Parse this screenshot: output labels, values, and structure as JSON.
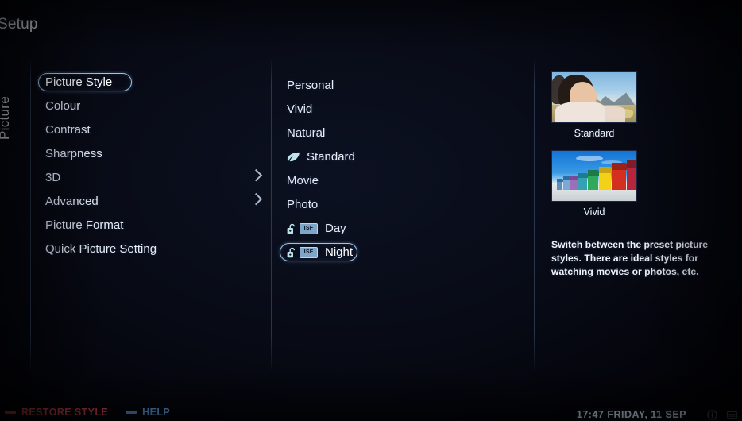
{
  "header": {
    "title": "Setup",
    "category_label": "Picture"
  },
  "left_menu": {
    "items": [
      {
        "label": "Picture Style",
        "selected": true,
        "has_submenu": false
      },
      {
        "label": "Colour",
        "selected": false,
        "has_submenu": false
      },
      {
        "label": "Contrast",
        "selected": false,
        "has_submenu": false
      },
      {
        "label": "Sharpness",
        "selected": false,
        "has_submenu": false
      },
      {
        "label": "3D",
        "selected": false,
        "has_submenu": true
      },
      {
        "label": "Advanced",
        "selected": false,
        "has_submenu": true
      },
      {
        "label": "Picture Format",
        "selected": false,
        "has_submenu": false
      },
      {
        "label": "Quick Picture Setting",
        "selected": false,
        "has_submenu": false
      }
    ]
  },
  "style_list": {
    "items": [
      {
        "label": "Personal",
        "selected": false,
        "icons": []
      },
      {
        "label": "Vivid",
        "selected": false,
        "icons": []
      },
      {
        "label": "Natural",
        "selected": false,
        "icons": []
      },
      {
        "label": "Standard",
        "selected": false,
        "icons": [
          "leaf-icon"
        ]
      },
      {
        "label": "Movie",
        "selected": false,
        "icons": []
      },
      {
        "label": "Photo",
        "selected": false,
        "icons": []
      },
      {
        "label": "Day",
        "selected": false,
        "icons": [
          "unlock-icon",
          "isf-badge"
        ],
        "badge_text": "ISF"
      },
      {
        "label": "Night",
        "selected": true,
        "icons": [
          "unlock-icon",
          "isf-badge"
        ],
        "badge_text": "ISF"
      }
    ]
  },
  "info_panel": {
    "previews": [
      {
        "caption": "Standard"
      },
      {
        "caption": "Vivid"
      }
    ],
    "description": "Switch between the preset picture styles. There are ideal styles for watching movies or photos, etc."
  },
  "bottom_bar": {
    "restore_label": "RESTORE STYLE",
    "help_label": "HELP",
    "clock": "17:47 FRIDAY, 11 SEP"
  },
  "colors": {
    "background": "#05070f",
    "selection_border": "#9fc4e8",
    "text": "#e6ecf7",
    "restore_red": "#cf3b45",
    "help_blue": "#4f8fd6"
  }
}
